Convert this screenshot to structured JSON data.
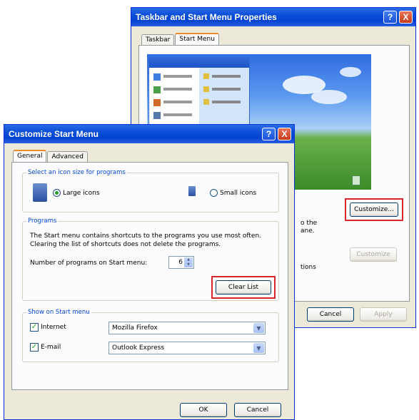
{
  "back_window": {
    "title": "Taskbar and Start Menu Properties",
    "tabs": [
      "Taskbar",
      "Start Menu"
    ],
    "active_tab": "Start Menu",
    "fragment_text_1a": "o the",
    "fragment_text_1b": "ane.",
    "fragment_text_2": "tions",
    "buttons": {
      "customize_1": "Customize...",
      "customize_2": "Customize",
      "cancel": "Cancel",
      "apply": "Apply"
    }
  },
  "front_window": {
    "title": "Customize Start Menu",
    "tabs": [
      "General",
      "Advanced"
    ],
    "active_tab": "General",
    "icon_size_group": {
      "label": "Select an icon size for programs",
      "large": "Large icons",
      "small": "Small icons",
      "selected": "Large icons"
    },
    "programs_group": {
      "label": "Programs",
      "desc_1": "The Start menu contains shortcuts to the programs you use most often.",
      "desc_2": "Clearing the list of shortcuts does not delete the programs.",
      "count_label": "Number of programs on Start menu:",
      "count_value": "6",
      "clear_button": "Clear List"
    },
    "show_group": {
      "label": "Show on Start menu",
      "internet_label": "Internet",
      "internet_checked": true,
      "internet_value": "Mozilla Firefox",
      "email_label": "E-mail",
      "email_checked": true,
      "email_value": "Outlook Express"
    },
    "buttons": {
      "ok": "OK",
      "cancel": "Cancel"
    }
  },
  "icons": {
    "help": "?",
    "close": "X",
    "check": "✓",
    "dropdown": "▼",
    "spin_up": "▲",
    "spin_down": "▼"
  },
  "colors": {
    "titlebar": "#0a4ed6",
    "highlight_box": "#d8232a",
    "group_label": "#0046d5"
  }
}
